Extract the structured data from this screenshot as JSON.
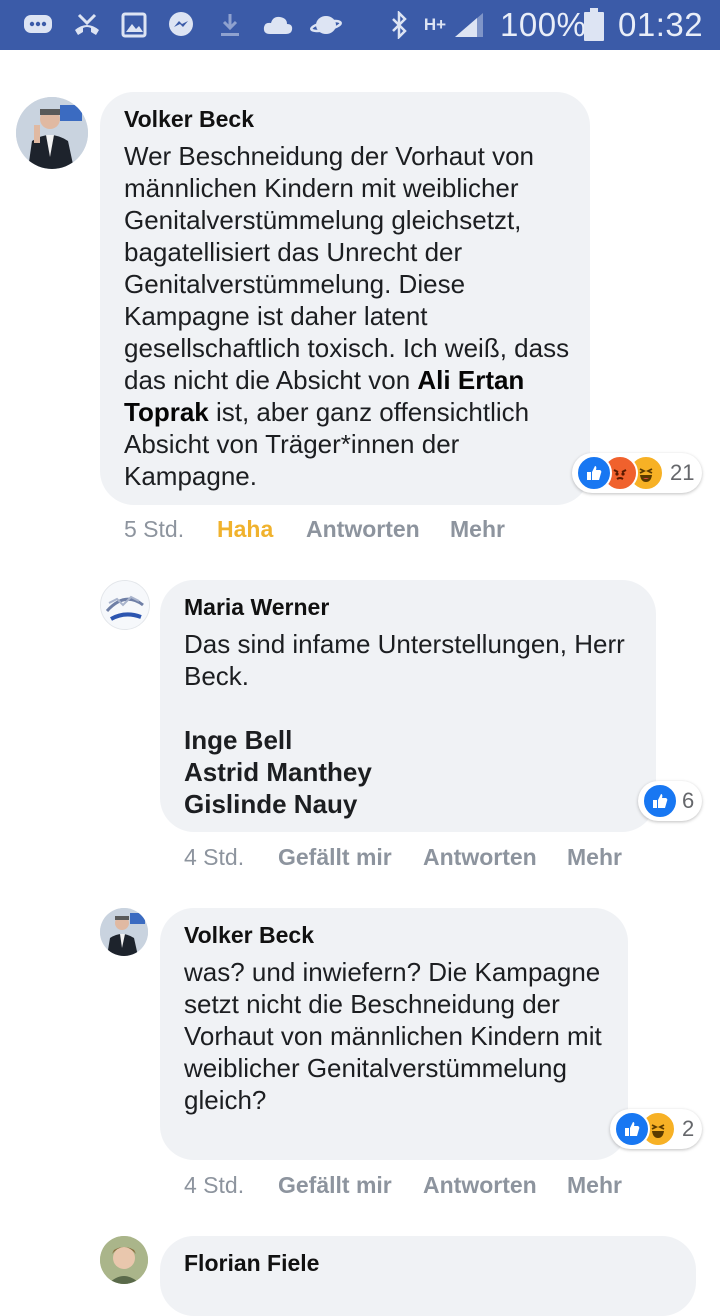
{
  "status_bar": {
    "battery": "100%",
    "time": "01:32",
    "network": "H+"
  },
  "comments": [
    {
      "author": "Volker Beck",
      "body_before": "Wer Beschneidung der Vorhaut von männlichen Kindern mit weiblicher Genitalverstümmelung gleichsetzt, bagatellisiert das Unrecht der Genitalverstümmelung. Diese Kampagne ist daher latent gesellschaftlich toxisch. Ich weiß, dass das nicht die Absicht von ",
      "mention": "Ali Ertan Toprak",
      "body_after": " ist, aber ganz offensichtlich Absicht von Träger*innen der Kampagne.",
      "reaction_count": "21",
      "time": "5 Std.",
      "like_label": "Haha",
      "reply_label": "Antworten",
      "more_label": "Mehr"
    },
    {
      "author": "Maria Werner",
      "body": "Das sind infame Unterstellungen, Herr Beck.",
      "mentions": [
        "Inge Bell",
        "Astrid Manthey",
        "Gislinde Nauy"
      ],
      "reaction_count": "6",
      "time": "4 Std.",
      "like_label": "Gefällt mir",
      "reply_label": "Antworten",
      "more_label": "Mehr"
    },
    {
      "author": "Volker Beck",
      "body": "was? und inwiefern? Die Kampagne setzt nicht die Beschneidung der Vorhaut von männlichen Kindern mit weiblicher Genitalverstümmelung gleich?",
      "reaction_count": "2",
      "time": "4 Std.",
      "like_label": "Gefällt mir",
      "reply_label": "Antworten",
      "more_label": "Mehr"
    },
    {
      "author": "Florian Fiele"
    }
  ],
  "colors": {
    "status_bar": "#3b5ba8",
    "bubble": "#f0f2f5",
    "haha_active": "#f0b22d",
    "meta_text": "#8d949e",
    "like_blue": "#1877f2",
    "angry": "#f0612d",
    "haha": "#f7b125"
  }
}
